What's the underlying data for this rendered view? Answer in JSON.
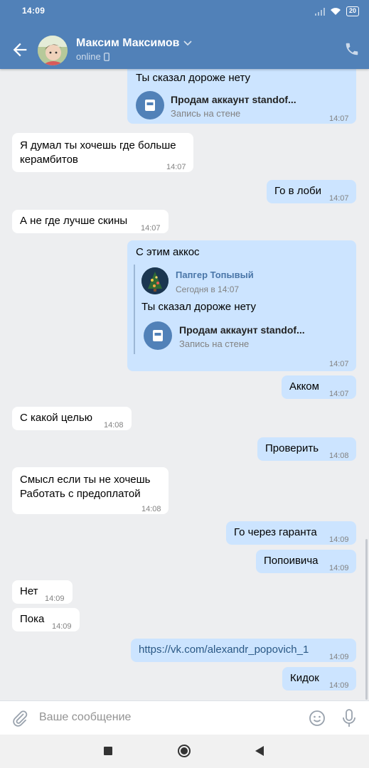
{
  "status_bar": {
    "time": "14:09",
    "battery": "20"
  },
  "header": {
    "name": "Максим Максимов",
    "status": "online",
    "avatar_icon": "avatar-photo",
    "back_icon": "arrow-left-icon",
    "call_icon": "phone-icon",
    "color": "#5181b8"
  },
  "messages": [
    {
      "dir": "out",
      "text": "Ты сказал дороже нету",
      "attachment": {
        "title": "Продам аккаунт standof...",
        "subtitle": "Запись на стене"
      },
      "time": "14:07"
    },
    {
      "dir": "in",
      "text1": "Я думал ты хочешь где больше",
      "text2": "керамбитов",
      "time": "14:07"
    },
    {
      "dir": "out",
      "text": "Го в лоби",
      "time": "14:07"
    },
    {
      "dir": "in",
      "text": "А не где лучше скины",
      "time": "14:07"
    },
    {
      "dir": "out",
      "text": "С этим аккос",
      "forward": {
        "author": "Папгер Топывый",
        "date": "Сегодня в 14:07",
        "text": "Ты сказал дороже нету",
        "attachment": {
          "title": "Продам аккаунт standof...",
          "subtitle": "Запись на стене"
        }
      },
      "time": "14:07"
    },
    {
      "dir": "out",
      "text": "Акком",
      "time": "14:07"
    },
    {
      "dir": "in",
      "text": "С какой целью",
      "time": "14:08"
    },
    {
      "dir": "out",
      "text": "Проверить",
      "time": "14:08"
    },
    {
      "dir": "in",
      "text1": "Смысл если ты не хочешь",
      "text2": "Работать с предоплатой",
      "time": "14:08"
    },
    {
      "dir": "out",
      "text": "Го через гаранта",
      "time": "14:09"
    },
    {
      "dir": "out",
      "text": "Попоивича",
      "time": "14:09"
    },
    {
      "dir": "in",
      "text": "Нет",
      "time": "14:09"
    },
    {
      "dir": "in",
      "text": "Пока",
      "time": "14:09"
    },
    {
      "dir": "out",
      "text": "https://vk.com/alexandr_popovich_1",
      "time": "14:09"
    },
    {
      "dir": "out",
      "text": "Кидок",
      "time": "14:09"
    }
  ],
  "composer": {
    "placeholder": "Ваше сообщение",
    "attach_icon": "paperclip-icon",
    "emoji_icon": "smile-icon",
    "mic_icon": "microphone-icon"
  },
  "colors": {
    "outgoing": "#cce4ff",
    "incoming": "#ffffff",
    "background": "#edeef0",
    "link": "#2a5885"
  }
}
